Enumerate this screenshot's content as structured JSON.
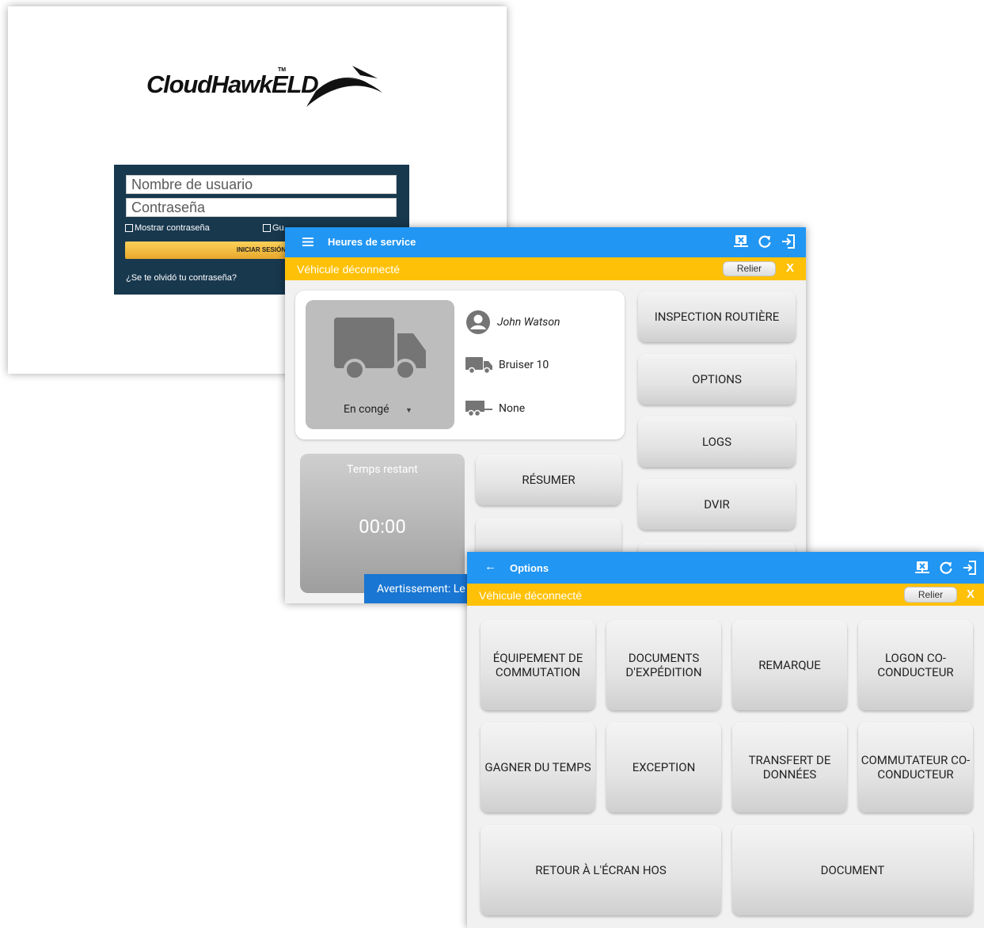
{
  "login": {
    "username_placeholder": "Nombre de usuario",
    "password_placeholder": "Contraseña",
    "show_password": "Mostrar contraseña",
    "remember": "Gu...",
    "login_button": "INICIAR SESIÓN",
    "forgot": "¿Se te olvidó tu contraseña?"
  },
  "hos": {
    "title": "Heures de service",
    "notice": "Véhicule déconnecté",
    "connect": "Relier",
    "close": "X",
    "status": "En congé",
    "driver": "John Watson",
    "vehicle": "Bruiser 10",
    "trailer": "None",
    "timer_label": "Temps restant",
    "timer_value": "00:00",
    "warning": "Avertissement: Le",
    "buttons": {
      "roadside": "INSPECTION ROUTIÈRE",
      "options": "OPTIONS",
      "logs": "LOGS",
      "dvir": "DVIR",
      "resume": "RÉSUMER"
    }
  },
  "options": {
    "title": "Options",
    "notice": "Véhicule déconnecté",
    "connect": "Relier",
    "close": "X",
    "buttons": {
      "equipment": "ÉQUIPEMENT DE COMMUTATION",
      "shipping": "DOCUMENTS D'EXPÉDITION",
      "remark": "REMARQUE",
      "codriver_logon": "LOGON CO-CONDUCTEUR",
      "gain_time": "GAGNER DU TEMPS",
      "exception": "EXCEPTION",
      "data_transfer": "TRANSFERT DE DONNÉES",
      "codriver_switch": "COMMUTATEUR CO-CONDUCTEUR",
      "back_hos": "RETOUR À L'ÉCRAN HOS",
      "document": "DOCUMENT"
    }
  },
  "colors": {
    "appbar": "#2196f3",
    "notice": "#ffc107",
    "login_box": "#18384e"
  }
}
